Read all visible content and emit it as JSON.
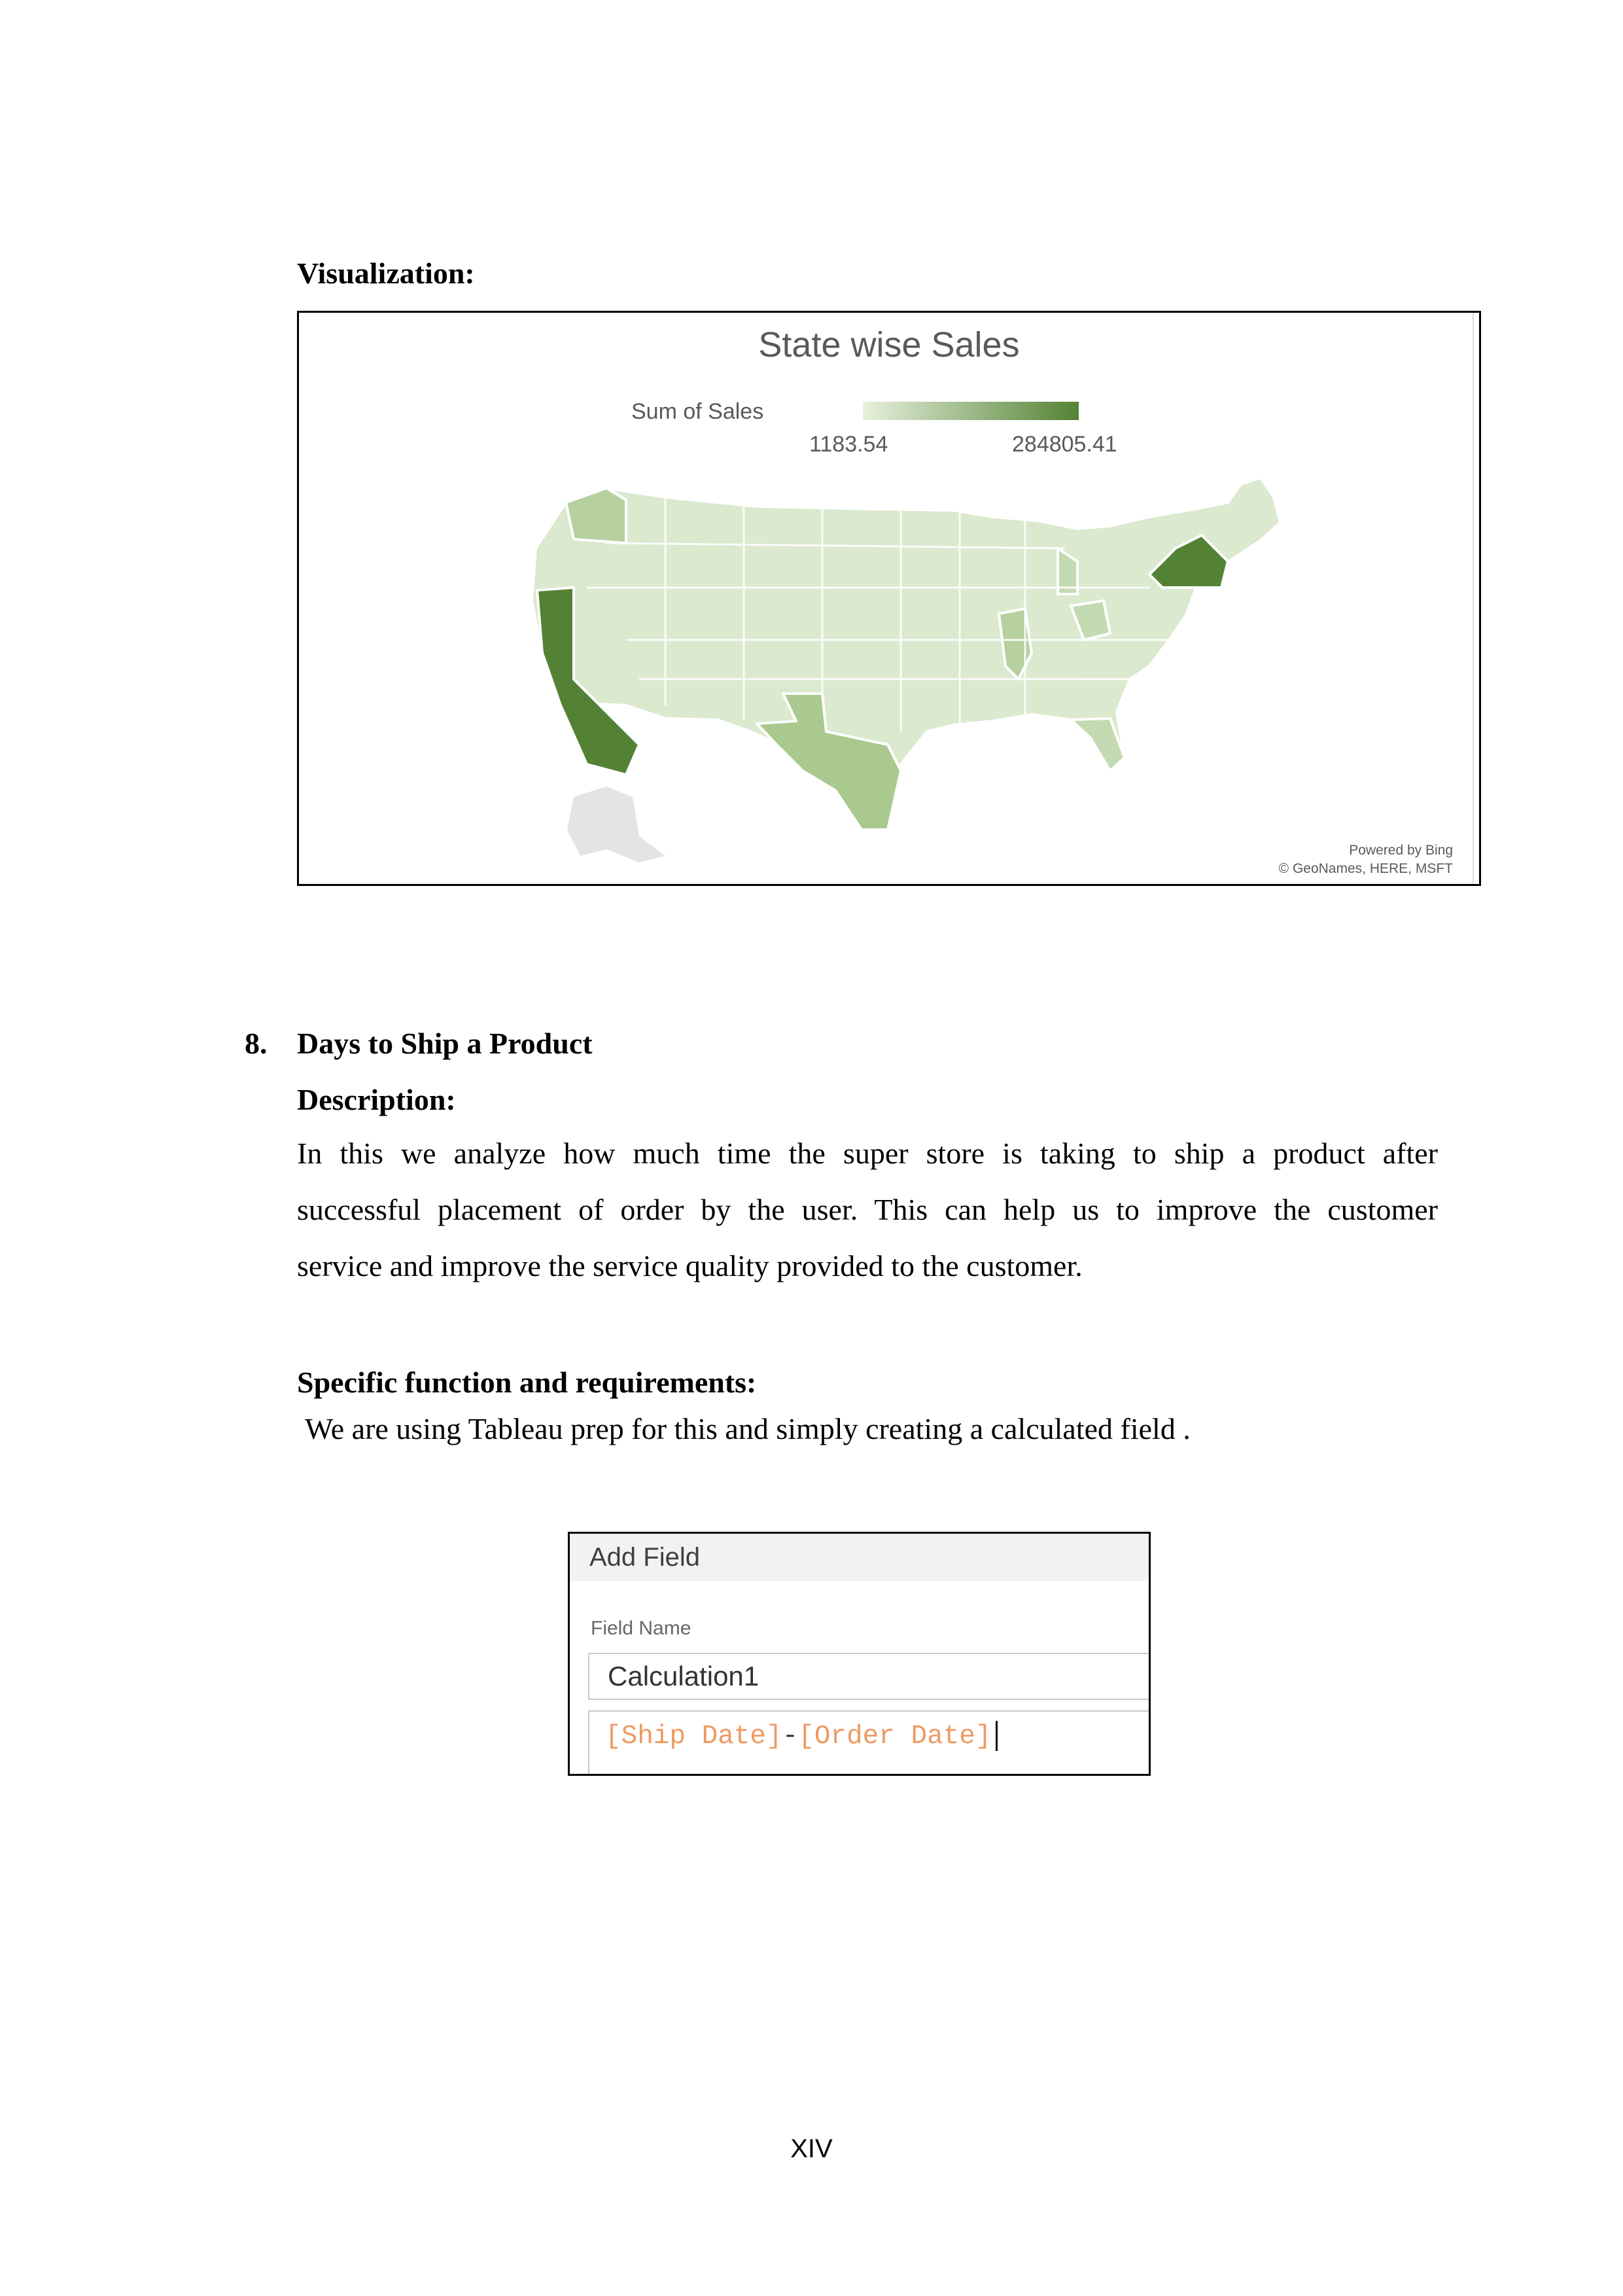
{
  "visualization_heading": "Visualization:",
  "map": {
    "title": "State wise Sales",
    "legend_label": "Sum of Sales",
    "legend_min": "1183.54",
    "legend_max": "284805.41",
    "credit_line1": "Powered by Bing",
    "credit_line2": "© GeoNames, HERE, MSFT",
    "colors": {
      "low": "#e6f0dc",
      "high": "#548235",
      "mid": "#a9c98e"
    }
  },
  "section": {
    "number": "8.",
    "title": "Days to Ship a Product",
    "description_heading": "Description:",
    "description_line1": "In this we analyze how much time the super store is taking to ship a product after",
    "description_line2": "successful placement of order by the user. This can help us to improve the customer",
    "description_line3": "service and improve the service quality provided to the customer.",
    "requirements_heading": "Specific function and requirements:",
    "requirements_text": "We are using Tableau prep for this and simply creating a calculated field ."
  },
  "add_field": {
    "title": "Add Field",
    "field_name_label": "Field Name",
    "field_name_value": "Calculation1",
    "expr_part1": "[Ship Date]",
    "expr_op": "-",
    "expr_part2": "[Order Date]",
    "expr_color": "#ee9a62"
  },
  "page_number": "XIV"
}
